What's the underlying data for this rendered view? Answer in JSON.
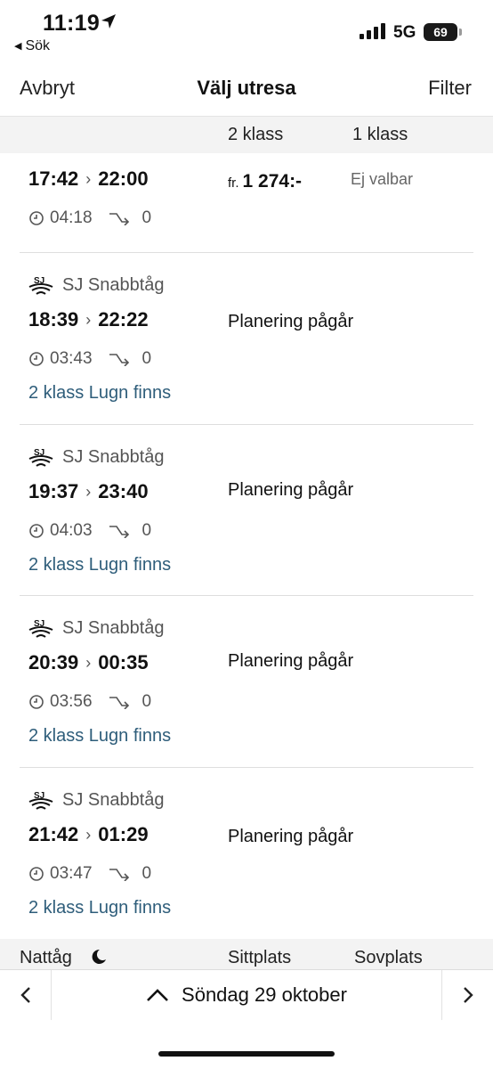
{
  "status_bar": {
    "time": "11:19",
    "back_label": "Sök",
    "network": "5G",
    "battery": "69"
  },
  "nav": {
    "cancel": "Avbryt",
    "title": "Välj utresa",
    "filter": "Filter"
  },
  "class_header": {
    "second": "2 klass",
    "first": "1 klass"
  },
  "trips": [
    {
      "operator": "",
      "depart": "17:42",
      "arrive": "22:00",
      "duration": "04:18",
      "changes": "0",
      "price_prefix": "fr.",
      "price": "1 274:-",
      "first_class": "Ej valbar",
      "status": "",
      "lugn": ""
    },
    {
      "operator": "SJ Snabbtåg",
      "depart": "18:39",
      "arrive": "22:22",
      "duration": "03:43",
      "changes": "0",
      "status": "Planering pågår",
      "lugn": "2 klass Lugn finns"
    },
    {
      "operator": "SJ Snabbtåg",
      "depart": "19:37",
      "arrive": "23:40",
      "duration": "04:03",
      "changes": "0",
      "status": "Planering pågår",
      "lugn": "2 klass Lugn finns"
    },
    {
      "operator": "SJ Snabbtåg",
      "depart": "20:39",
      "arrive": "00:35",
      "duration": "03:56",
      "changes": "0",
      "status": "Planering pågår",
      "lugn": "2 klass Lugn finns"
    },
    {
      "operator": "SJ Snabbtåg",
      "depart": "21:42",
      "arrive": "01:29",
      "duration": "03:47",
      "changes": "0",
      "status": "Planering pågår",
      "lugn": "2 klass Lugn finns"
    }
  ],
  "night_section": {
    "label": "Nattåg",
    "seat": "Sittplats",
    "sleeper": "Sovplats"
  },
  "date_bar": {
    "date": "Söndag 29 oktober"
  },
  "colors": {
    "link": "#2e5d7a",
    "header_bg": "#f3f3f3"
  }
}
